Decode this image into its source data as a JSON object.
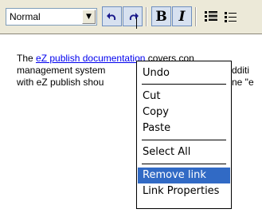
{
  "toolbar": {
    "style_value": "Normal",
    "style_arrow": "▼",
    "undo_glyph": "↶",
    "redo_glyph": "↷",
    "bold_label": "B",
    "italic_label": "I",
    "ordered_list_icon": "numbered-list-icon",
    "bullet_list_icon": "bullet-list-icon"
  },
  "editor": {
    "line1_before": "The ",
    "line1_link": "eZ publish documentation",
    "line1_after": " covers con",
    "line2": "management system",
    "line2_tail": "dditi",
    "line3": "with eZ publish shou",
    "line3_tail": "ne \"e"
  },
  "context_menu": {
    "items": [
      {
        "label": "Undo"
      },
      {
        "label": "Cut"
      },
      {
        "label": "Copy"
      },
      {
        "label": "Paste"
      },
      {
        "label": "Select All"
      },
      {
        "label": "Remove link",
        "highlighted": true
      },
      {
        "label": "Link Properties"
      }
    ]
  },
  "colors": {
    "toolbar_bg": "#ece9d8",
    "button_bg": "#d7e1f0",
    "link": "#0000ee",
    "menu_highlight": "#316ac5"
  }
}
